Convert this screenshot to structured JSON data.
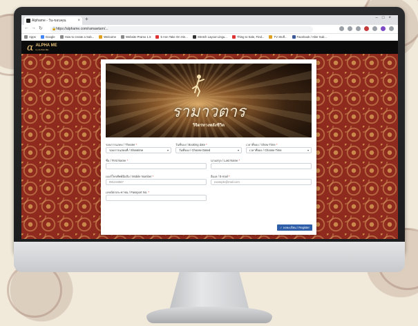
{
  "browser": {
    "tab_title": "Alphame - วัน-ขอบคุณ",
    "url": "https://alphame.com/ramawtarn/..."
  },
  "bookmarks": [
    {
      "label": "Apps"
    },
    {
      "label": "Google"
    },
    {
      "label": "How to create a Sub..."
    },
    {
      "label": "Welcome"
    },
    {
      "label": "Website Pramo 1.5"
    },
    {
      "label": "5 Ann Take On Hin..."
    },
    {
      "label": "Stretch Layout Lingu..."
    },
    {
      "label": "Thing to Sale, Find..."
    },
    {
      "label": "TV Stuff..."
    },
    {
      "label": "Facebook / Alter Sub..."
    }
  ],
  "site": {
    "logo_symbol": "α",
    "logo_name": "ALPHA ME",
    "logo_tagline": "by ALPHA ME"
  },
  "banner": {
    "title": "รามาวตาร",
    "subtitle": "วิจิตรทางพลังชีวิต"
  },
  "form": {
    "row1": [
      {
        "label": "รอบการแสดง / Theater",
        "value": "รอบการแสดงที่ / Showtime"
      },
      {
        "label": "วันที่จอง / Booking date",
        "value": "วันที่จอง / Choose Dated"
      },
      {
        "label": "เวลาที่จอง / Show Time",
        "value": "เวลาที่จอง / Choose Time"
      }
    ],
    "first_name": {
      "label": "ชื่อ / First Name",
      "placeholder": ""
    },
    "last_name": {
      "label": "นามสกุล / Last Name",
      "placeholder": ""
    },
    "phone": {
      "label": "เบอร์โทรศัพท์มือถือ / Mobile Number",
      "placeholder": "081234567"
    },
    "email": {
      "label": "อีเมล / E-mail",
      "placeholder": "example@mail.com"
    },
    "id_card": {
      "label": "เลขบัตรประชาชน / Passport No.",
      "placeholder": ""
    },
    "submit_label": "ลงทะเบียน / Register"
  },
  "colors": {
    "page_bg": "#8e2a1e",
    "pattern": "#c9874a",
    "header_bg": "#0b0b0b",
    "logo_gold": "#e6c27a",
    "button": "#2f5ea8"
  }
}
